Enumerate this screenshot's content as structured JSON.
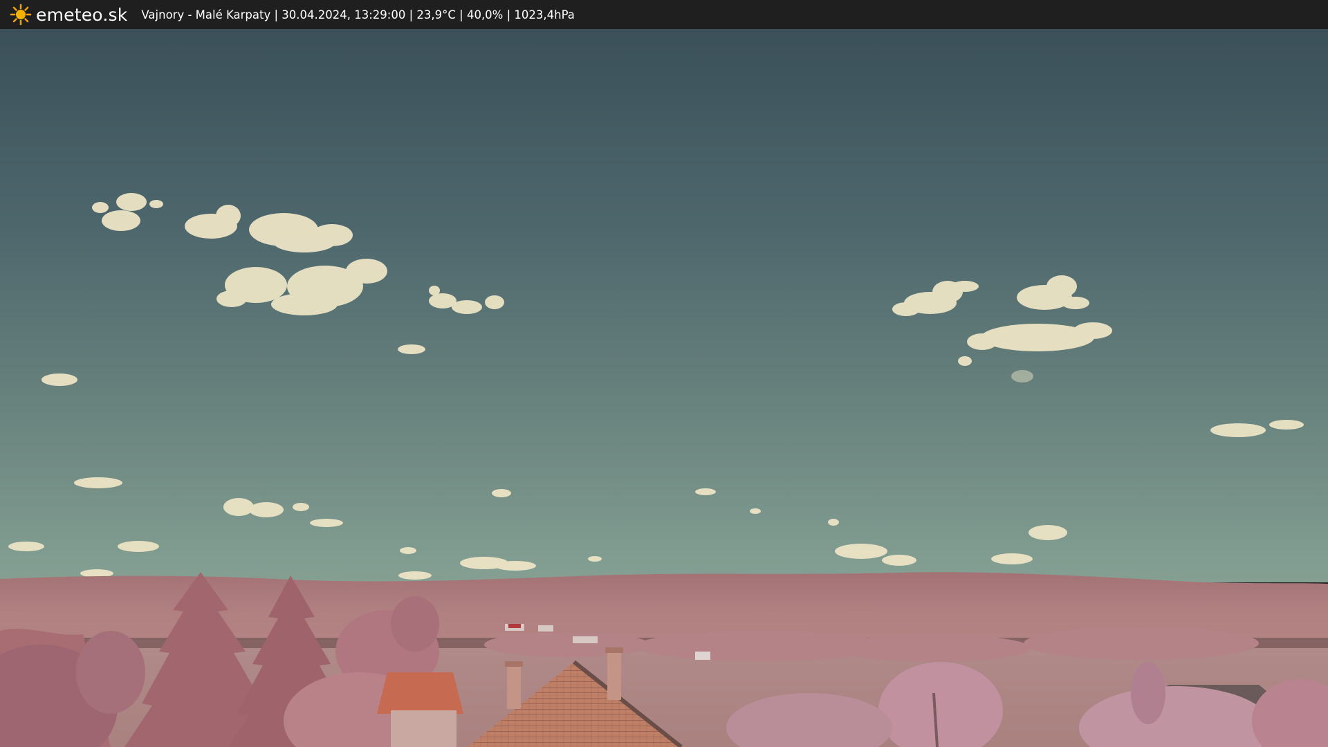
{
  "header": {
    "brand": "emeteo.sk",
    "logo_icon": "sun-icon",
    "caption": "Vajnory - Malé Karpaty | 30.04.2024, 13:29:00 | 23,9°C | 40,0% | 1023,4hPa"
  },
  "colors": {
    "bar": "#1f1f1f",
    "sky_top": "#3e545c",
    "sky_horizon": "#7e9890",
    "hills": "#a8797b",
    "foliage": "#b77f85",
    "roof": "#c8735c"
  }
}
